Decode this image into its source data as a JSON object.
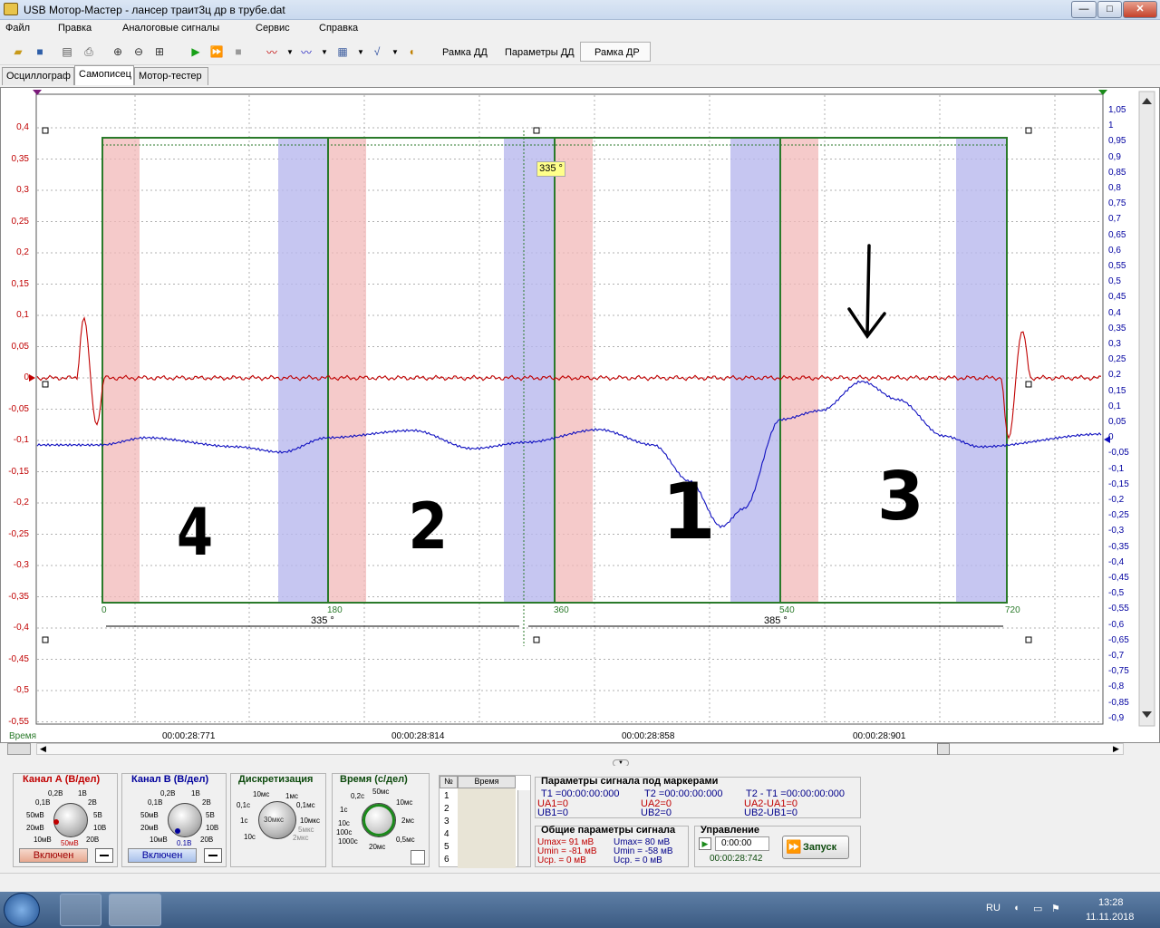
{
  "window": {
    "title": "USB Мотор-Мастер - лансер траит3ц др в трубе.dat",
    "min": "—",
    "max": "□",
    "close": "✕"
  },
  "menu": [
    "Файл",
    "Правка",
    "Аналоговые сигналы",
    "Сервис",
    "Справка"
  ],
  "toolbar": {
    "frame_dd": "Рамка ДД",
    "params_dd": "Параметры ДД",
    "frame_dr": "Рамка ДР"
  },
  "tabs": [
    "Осциллограф",
    "Самописец",
    "Мотор-тестер"
  ],
  "plot": {
    "left_ticks": [
      "0,4",
      "0,35",
      "0,3",
      "0,25",
      "0,2",
      "0,15",
      "0,1",
      "0,05",
      "0",
      "-0,05",
      "-0,1",
      "-0,15",
      "-0,2",
      "-0,25",
      "-0,3",
      "-0,35",
      "-0,4",
      "-0,45",
      "-0,5",
      "-0,55"
    ],
    "right_ticks": [
      "1,05",
      "1",
      "0,95",
      "0,9",
      "0,85",
      "0,8",
      "0,75",
      "0,7",
      "0,65",
      "0,6",
      "0,55",
      "0,5",
      "0,45",
      "0,4",
      "0,35",
      "0,3",
      "0,25",
      "0,2",
      "0,15",
      "0,1",
      "0,05",
      "0",
      "-0,05",
      "-0,1",
      "-0,15",
      "-0,2",
      "-0,25",
      "-0,3",
      "-0,35",
      "-0,4",
      "-0,45",
      "-0,5",
      "-0,55",
      "-0,6",
      "-0,65",
      "-0,7",
      "-0,75",
      "-0,8",
      "-0,85",
      "-0,9"
    ],
    "time_label": "Время",
    "time_ticks": [
      "00:00:28:771",
      "00:00:28:814",
      "00:00:28:858",
      "00:00:28:901"
    ],
    "degree_ticks": [
      "0",
      "180",
      "360",
      "540",
      "720"
    ],
    "angle_left": "335 °",
    "angle_right": "385 °",
    "marker_label": "335 °",
    "cylinders": [
      "4",
      "2",
      "1",
      "3"
    ],
    "red_color": "#c00000",
    "blue_color": "#1010c0"
  },
  "channel_a": {
    "title": "Канал А (В/дел)",
    "labels": [
      "0,2В",
      "1В",
      "0,1В",
      "2В",
      "50мВ",
      "5В",
      "20мВ",
      "10В",
      "10мВ",
      "50мВ",
      "20В"
    ],
    "state": "Включен",
    "color": "#c00000"
  },
  "channel_b": {
    "title": "Канал В (В/дел)",
    "labels": [
      "0,2В",
      "1В",
      "0,1В",
      "2В",
      "50мВ",
      "5В",
      "20мВ",
      "10В",
      "10мВ",
      "0.1В",
      "20В"
    ],
    "state": "Включен",
    "color": "#00009c"
  },
  "sampling": {
    "title": "Дискретизация",
    "labels": [
      "10мс",
      "1мс",
      "0,1с",
      "0,1мс",
      "1с",
      "10мкс",
      "10с",
      "2мкс",
      "5мкс",
      "30мкс"
    ]
  },
  "timebase": {
    "title": "Время (с/дел)",
    "labels": [
      "0,2с",
      "50мс",
      "1с",
      "10мс",
      "10с",
      "2мс",
      "100с",
      "0,5мс",
      "1000с",
      "20мс"
    ]
  },
  "markers_table": {
    "col_no": "№",
    "col_time": "Время",
    "rows": [
      "1",
      "2",
      "3",
      "4",
      "5",
      "6"
    ]
  },
  "signal_params": {
    "title": "Параметры сигнала под маркерами",
    "t1": "T1 =00:00:00:000",
    "t2": "T2 =00:00:00:000",
    "dt": "T2 - T1 =00:00:00:000",
    "ua1": "UA1=0",
    "ub1": "UB1=0",
    "ua2": "UA2=0",
    "ub2": "UB2=0",
    "dua": "UA2-UA1=0",
    "dub": "UB2-UB1=0"
  },
  "general_params": {
    "title": "Общие параметры сигнала",
    "a_max": "Umax= 91 мВ",
    "a_min": "Umin = -81 мВ",
    "a_avg": "Uср. =  0 мВ",
    "b_max": "Umax= 80 мВ",
    "b_min": "Umin = -58 мВ",
    "b_avg": "Uср. =  0 мВ"
  },
  "control": {
    "title": "Управление",
    "time_input": "0:00:00",
    "elapsed": "00:00:28:742",
    "start": "Запуск"
  },
  "tray": {
    "lang": "RU",
    "time": "13:28",
    "date": "11.11.2018"
  }
}
